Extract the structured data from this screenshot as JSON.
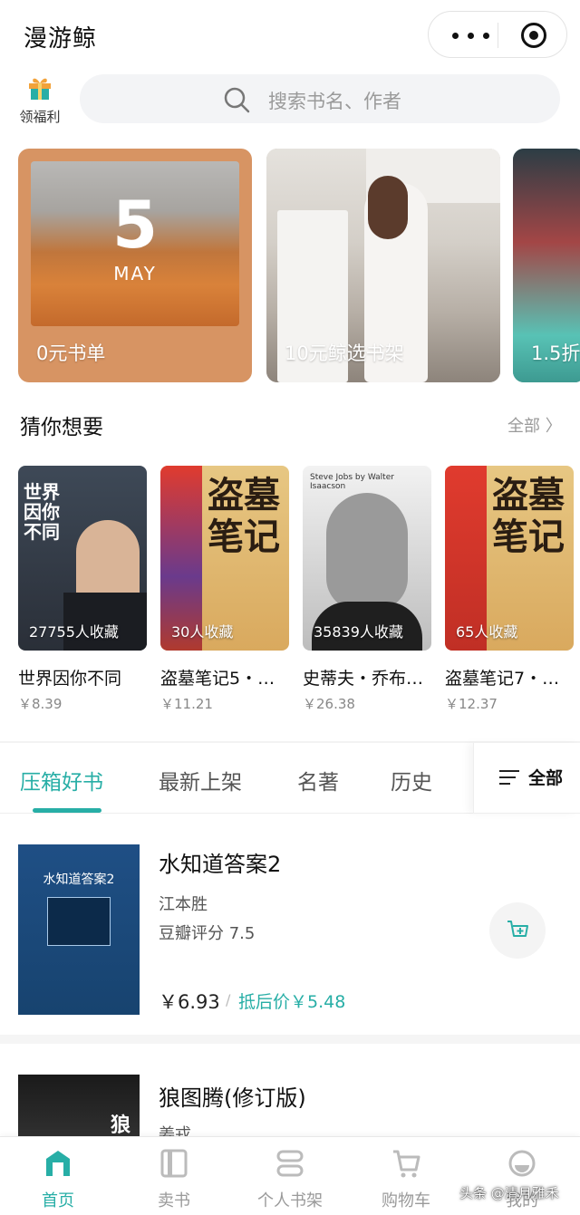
{
  "header": {
    "title": "漫游鲸"
  },
  "gift": {
    "label": "领福利"
  },
  "search": {
    "placeholder": "搜索书名、作者"
  },
  "banners": [
    {
      "label": "0元书单",
      "day": "5",
      "month": "MAY"
    },
    {
      "label": "10元鲸选书架"
    },
    {
      "label": "1.5折"
    }
  ],
  "guess": {
    "title": "猜你想要",
    "all_label": "全部 〉",
    "books": [
      {
        "cover_text": "世界因你不同",
        "count": "27755人收藏",
        "name": "世界因你不同",
        "price": "￥8.39"
      },
      {
        "cover_text": "盗墓笔记",
        "count": "30人收藏",
        "name": "盗墓笔记5・…",
        "price": "￥11.21"
      },
      {
        "cover_text": "Steve Jobs by Walter Isaacson",
        "count": "35839人收藏",
        "name": "史蒂夫・乔布…",
        "price": "￥26.38"
      },
      {
        "cover_text": "盗墓笔记",
        "count": "65人收藏",
        "name": "盗墓笔记7・…",
        "price": "￥12.37"
      }
    ]
  },
  "tabs": {
    "items": [
      "压箱好书",
      "最新上架",
      "名著",
      "历史"
    ],
    "all_label": "全部"
  },
  "list": [
    {
      "cover_text": "水知道答案2",
      "title": "水知道答案2",
      "author": "江本胜",
      "rating": "豆瓣评分 7.5",
      "price": "￥6.93",
      "sep": "/",
      "after_price": "抵后价￥5.48"
    },
    {
      "cover_text": "狼图",
      "title": "狼图腾(修订版)",
      "author": "姜戎"
    }
  ],
  "nav": [
    {
      "label": "首页",
      "icon": "home-icon",
      "active": true
    },
    {
      "label": "卖书",
      "icon": "sell-book-icon"
    },
    {
      "label": "个人书架",
      "icon": "bookshelf-icon"
    },
    {
      "label": "购物车",
      "icon": "cart-icon"
    },
    {
      "label": "我的",
      "icon": "profile-icon"
    }
  ],
  "watermark": "头条 @清月雅禾",
  "colors": {
    "accent": "#27aea6",
    "banner_orange": "#d79463"
  }
}
